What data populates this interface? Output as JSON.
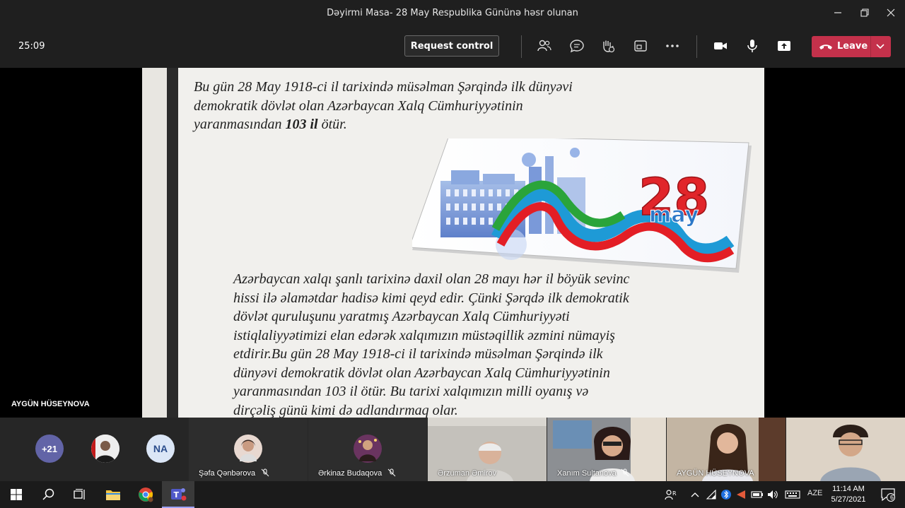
{
  "window": {
    "title": "Dəyirmi Masa- 28 May Respublika Gününə həsr olunan"
  },
  "toolbar": {
    "timer": "25:09",
    "request_control_label": "Request control",
    "leave_label": "Leave"
  },
  "stage": {
    "presenter_name": "AYGÜN HÜSEYNOVA",
    "slide": {
      "intro_lines": [
        "Bu gün 28 May 1918-ci il tarixində müsəlman Şərqində ilk dünyəvi",
        "demokratik dövlət olan Azərbaycan Xalq Cümhuriyyətinin"
      ],
      "intro_last_prefix": "yaranmasından ",
      "intro_bold": "103 il",
      "intro_last_suffix": " ötür.",
      "banner_number": "28",
      "banner_word": "may",
      "body_lines": [
        "Azərbaycan xalqı şanlı tarixinə daxil olan 28 mayı hər il  böyük sevinc",
        "hissi ilə əlamətdar hadisə kimi qeyd edir. Çünki Şərqdə ilk demokratik",
        "dövlət quruluşunu yaratmış Azərbaycan Xalq Cümhuriyyəti",
        "istiqlaliyyətimizi elan edərək xalqımızın müstəqillik əzmini nümayiş",
        "etdirir.Bu gün 28 May 1918-ci il tarixində müsəlman Şərqində ilk",
        "dünyəvi demokratik dövlət olan Azərbaycan Xalq Cümhuriyyətinin",
        "yaranmasından 103 il ötür. Bu tarixi xalqımızın milli oyanış və",
        "dirçəliş günü kimi də adlandırmaq olar."
      ]
    }
  },
  "gallery": {
    "overflow_count": "+21",
    "initials_avatar": "NA",
    "participants": [
      {
        "name": "Şəfa Qənbərova"
      },
      {
        "name": "Ərkinaz Budaqova"
      },
      {
        "name": "Ərzuman Əmirov"
      },
      {
        "name": "Xanım Sultanova"
      },
      {
        "name": "AYGÜN HÜSEYNOVA"
      },
      {
        "name": ""
      }
    ]
  },
  "taskbar": {
    "language": "AZE",
    "time": "11:14 AM",
    "date": "5/27/2021",
    "notification_count": "6"
  },
  "colors": {
    "leave_red": "#c4314b",
    "overflow_purple": "#6264a7",
    "initials_blue": "#dbe6f6"
  }
}
